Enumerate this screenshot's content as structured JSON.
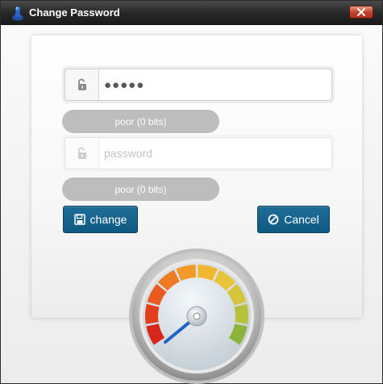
{
  "window": {
    "title": "Change Password",
    "icon": "app-icon",
    "close_icon": "close-icon"
  },
  "form": {
    "password_field": {
      "value": "●●●●●",
      "icon": "unlock-icon"
    },
    "password_strength_1": "poor (0 bits)",
    "confirm_field": {
      "placeholder": "password",
      "value": "",
      "icon": "unlock-icon"
    },
    "password_strength_2": "poor (0 bits)"
  },
  "buttons": {
    "change_label": "change",
    "change_icon": "save-icon",
    "cancel_label": "Cancel",
    "cancel_icon": "cancel-icon"
  },
  "gauge": {
    "icon": "strength-gauge",
    "level": 0.0
  },
  "colors": {
    "titlebar": "#262626",
    "button": "#1565a0",
    "strength_bar": "#bdbdbd"
  }
}
